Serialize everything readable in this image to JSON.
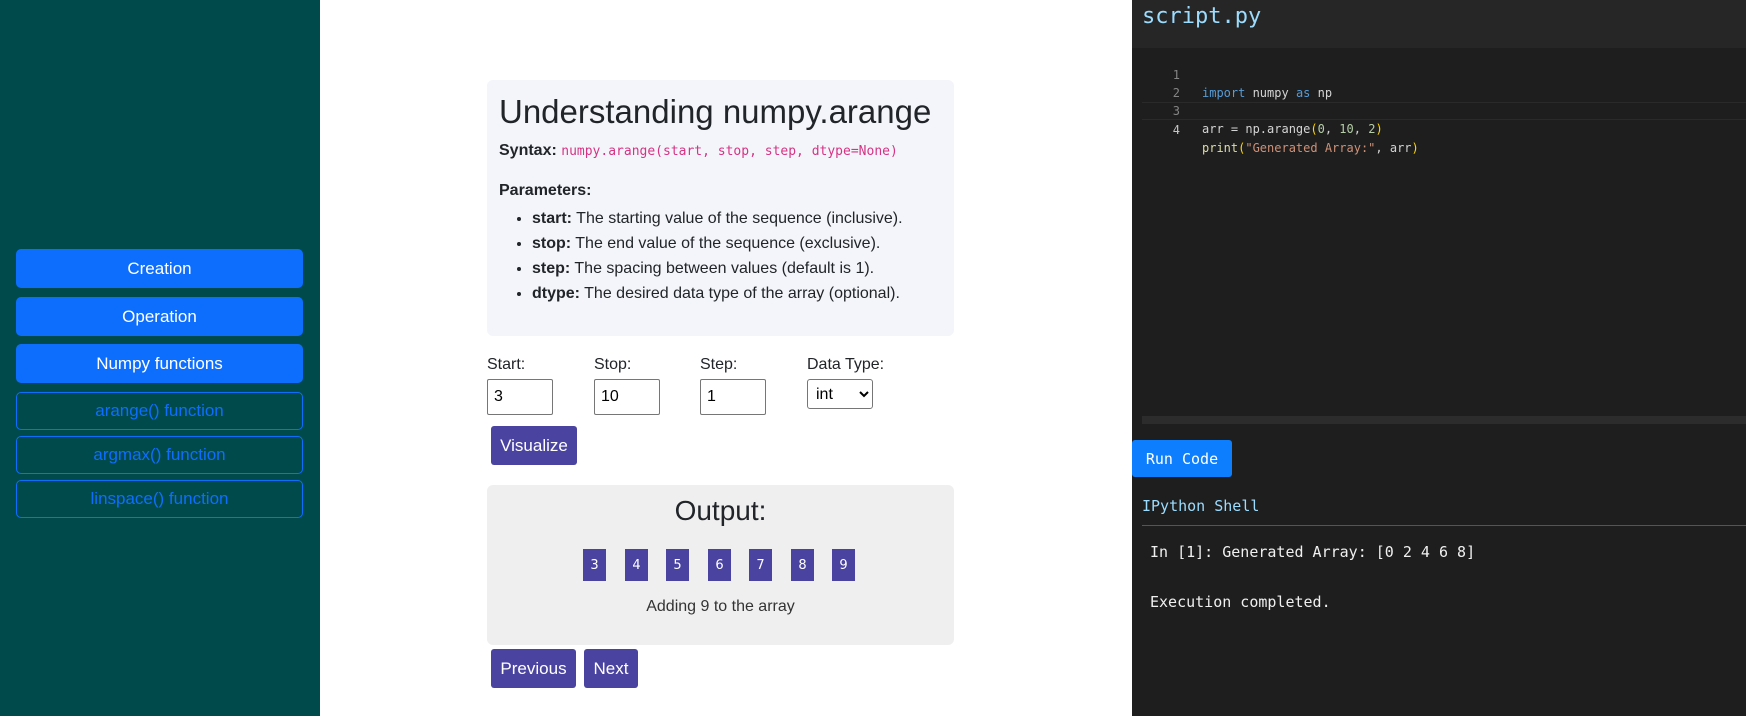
{
  "sidebar": {
    "items": [
      {
        "label": "Creation"
      },
      {
        "label": "Operation"
      },
      {
        "label": "Numpy functions"
      },
      {
        "label": "arange() function"
      },
      {
        "label": "argmax() function"
      },
      {
        "label": "linspace() function"
      }
    ]
  },
  "info": {
    "title": "Understanding numpy.arange",
    "syntax_label": "Syntax:",
    "syntax_code": "numpy.arange(start, stop, step, dtype=None)",
    "params_title": "Parameters:",
    "params": [
      {
        "name": "start:",
        "desc": "The starting value of the sequence (inclusive)."
      },
      {
        "name": "stop:",
        "desc": "The end value of the sequence (exclusive)."
      },
      {
        "name": "step:",
        "desc": "The spacing between values (default is 1)."
      },
      {
        "name": "dtype:",
        "desc": "The desired data type of the array (optional)."
      }
    ]
  },
  "form": {
    "start_label": "Start:",
    "start_value": "3",
    "stop_label": "Stop:",
    "stop_value": "10",
    "step_label": "Step:",
    "step_value": "1",
    "dtype_label": "Data Type:",
    "dtype_value": "int",
    "visualize_label": "Visualize"
  },
  "output": {
    "title": "Output:",
    "array": [
      "3",
      "4",
      "5",
      "6",
      "7",
      "8",
      "9"
    ],
    "message": "Adding 9 to the array",
    "prev_label": "Previous",
    "next_label": "Next"
  },
  "editor": {
    "filename": "script.py",
    "line_numbers": [
      "1",
      "2",
      "3",
      "4"
    ],
    "code_lines": [
      "import numpy as np",
      "",
      "arr = np.arange(0, 10, 2)",
      "print(\"Generated Array:\", arr)"
    ],
    "run_label": "Run Code"
  },
  "shell": {
    "title": "IPython Shell",
    "lines": [
      "In [1]: Generated Array: [0 2 4 6 8]",
      "Execution completed."
    ]
  },
  "colors": {
    "sidebar_bg": "#004a4c",
    "primary": "#0d6efd",
    "purple": "#4a44a0",
    "editor_bg": "#1e1e1e"
  }
}
